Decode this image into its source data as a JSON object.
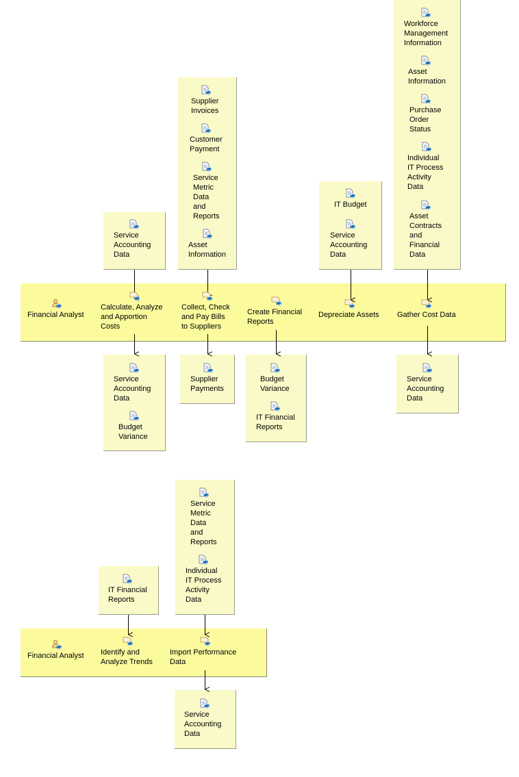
{
  "colors": {
    "lane_fill": "#fbfb9e",
    "box_fill": "#fafac8",
    "connector": "#000000",
    "icon_blue": "#1f6fb5",
    "icon_tan": "#c8a060"
  },
  "lane1": {
    "role": "Financial Analyst",
    "activities": [
      "Calculate, Analyze\nand Apportion\nCosts",
      "Collect, Check\nand Pay Bills\nto Suppliers",
      "Create Financial\nReports",
      "Depreciate Assets",
      "Gather Cost Data"
    ],
    "inputs": [
      [
        "Service\nAccounting\nData"
      ],
      [
        "Supplier\nInvoices",
        "Customer\nPayment",
        "Service\nMetric\nData\nand\nReports",
        "Asset\nInformation"
      ],
      [
        "IT Budget",
        "Service\nAccounting\nData"
      ],
      [
        "Workforce\nManagement\nInformation",
        "Asset\nInformation",
        "Purchase\nOrder\nStatus",
        "Individual\nIT Process\nActivity\nData",
        "Asset\nContracts\nand\nFinancial\nData"
      ]
    ],
    "outputs": [
      [
        "Service\nAccounting\nData",
        "Budget\nVariance"
      ],
      [
        "Supplier\nPayments"
      ],
      [
        "Budget\nVariance",
        "IT Financial\nReports"
      ],
      [
        "Service\nAccounting\nData"
      ]
    ]
  },
  "lane2": {
    "role": "Financial Analyst",
    "activities": [
      "Identify and\nAnalyze Trends",
      "Import Performance\nData"
    ],
    "inputs": [
      [
        "IT Financial\nReports"
      ],
      [
        "Service\nMetric\nData\nand\nReports",
        "Individual\nIT Process\nActivity\nData"
      ]
    ],
    "outputs": [
      [
        "Service\nAccounting\nData"
      ]
    ]
  },
  "icons": {
    "role": "performer-icon",
    "activity": "activity-icon",
    "artifact": "document-icon"
  }
}
